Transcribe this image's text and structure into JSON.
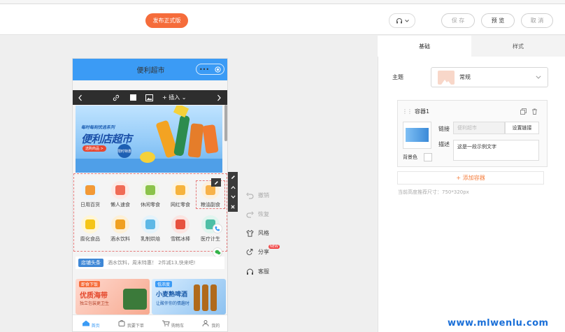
{
  "topbar": {
    "publish_label": "发布正式版",
    "save_label": "保 存",
    "preview_label": "预 览",
    "cancel_label": "取 消"
  },
  "phone": {
    "title": "便利超市",
    "capsule_dots": "•••",
    "toolbar": {
      "insert_label": "插入"
    },
    "banner": {
      "tagline": "每时每刻优选系列",
      "title": "便利店超市",
      "button": "选购商品 >",
      "badge": "限时特惠"
    },
    "categories": [
      {
        "label": "日用百货",
        "color": "#f29a38"
      },
      {
        "label": "懒人速食",
        "color": "#f06b56"
      },
      {
        "label": "休闲零食",
        "color": "#8bc34a"
      },
      {
        "label": "网红零食",
        "color": "#f6b33d"
      },
      {
        "label": "粮油副食",
        "color": "#f7b24a"
      },
      {
        "label": "膨化食品",
        "color": "#f5c518"
      },
      {
        "label": "酒水饮料",
        "color": "#f0a020"
      },
      {
        "label": "乳制烘焙",
        "color": "#5eb8e6"
      },
      {
        "label": "雪糕冰棒",
        "color": "#e7513f"
      },
      {
        "label": "医疗计生",
        "color": "#4dbfa6"
      }
    ],
    "shop": {
      "tag": "店铺头条",
      "text": "酒水饮料，周末特惠！ 2件减13,快来吧!"
    },
    "promos": [
      {
        "tag": "即食下饭",
        "title": "优质海带",
        "sub": "独立包装更卫生"
      },
      {
        "tag": "低浓度",
        "title": "小麦熟啤酒",
        "sub": "让酸伴你的情趣时"
      }
    ],
    "tabs": [
      {
        "label": "首页"
      },
      {
        "label": "我要下单"
      },
      {
        "label": "购物车"
      },
      {
        "label": "我的"
      }
    ]
  },
  "side_actions": {
    "undo": "撤销",
    "redo": "恢复",
    "style": "风格",
    "share": "分享",
    "share_badge": "NEW",
    "service": "客服"
  },
  "panel": {
    "tabs": {
      "basic": "基础",
      "style": "样式"
    },
    "theme_label": "主题",
    "theme_value": "常规",
    "container": {
      "name": "容器1",
      "link_label": "链接",
      "link_placeholder": "便利超市",
      "link_button": "设置链接",
      "desc_label": "描述",
      "desc_value": "这是一段示例文字",
      "bg_label": "背景色"
    },
    "add_container": "+ 添加容器",
    "size_hint": "当前高度推荐尺寸：750*320px"
  },
  "watermark": "www.mlwenlu.com"
}
